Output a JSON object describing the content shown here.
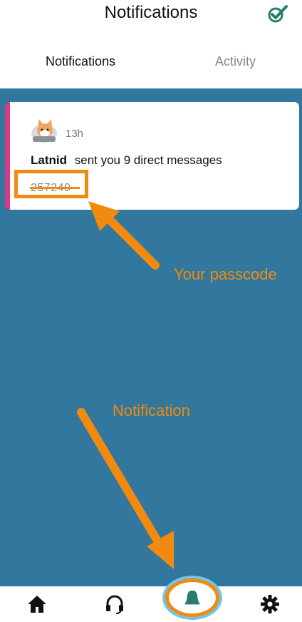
{
  "header": {
    "title": "Notifications",
    "check_icon": "check-badge-icon"
  },
  "tabs": [
    {
      "label": "Notifications",
      "active": true
    },
    {
      "label": "Activity",
      "active": false
    }
  ],
  "notifications": [
    {
      "avatar": "cat-avatar",
      "time": "13h",
      "sender": "Latnid",
      "text": "sent you 9 direct messages",
      "code": "257240"
    }
  ],
  "annotations": {
    "passcode_label": "Your passcode",
    "notification_label": "Notification"
  },
  "bottom_nav": [
    {
      "name": "home",
      "icon": "home-icon"
    },
    {
      "name": "support",
      "icon": "headphones-icon"
    },
    {
      "name": "notifications",
      "icon": "bell-icon",
      "active": true
    },
    {
      "name": "settings",
      "icon": "gear-icon"
    }
  ],
  "colors": {
    "background": "#31779e",
    "accent_strip": "#d63c83",
    "annotation": "#f28a0f",
    "active_icon": "#2a7d6a",
    "highlight_ring": "#72c6ea"
  }
}
